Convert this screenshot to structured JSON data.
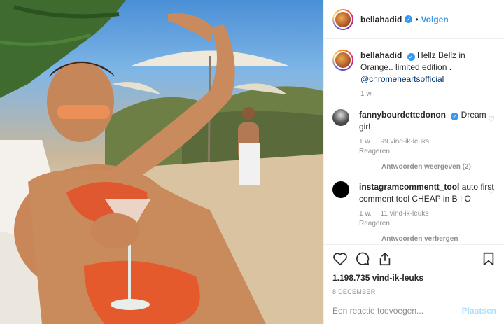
{
  "header": {
    "username": "bellahadid",
    "separator": "•",
    "follow_label": "Volgen"
  },
  "caption": {
    "username": "bellahadid",
    "text": "Hellz Bellz in Orange.. limited edition .",
    "mention": "@chromeheartsofficial",
    "age": "1 w."
  },
  "comments": [
    {
      "username": "fannybourdettedonon",
      "text": "Dream girl",
      "age": "1 w.",
      "likes": "99 vind-ik-leuks",
      "reply": "Reageren",
      "replies_toggle": "Antwoorden weergeven (2)"
    },
    {
      "username": "instagramcommentt_tool",
      "text": "auto first comment tool CHEAP in B I O",
      "age": "1 w.",
      "likes": "11 vind-ik-leuks",
      "reply": "Reageren",
      "replies_toggle": "Antwoorden verbergen"
    }
  ],
  "actions": {
    "likes": "1.198.735 vind-ik-leuks",
    "date": "8 DECEMBER",
    "icons": [
      "heart-icon",
      "comment-icon",
      "share-icon",
      "bookmark-icon"
    ]
  },
  "add_comment": {
    "placeholder": "Een reactie toevoegen...",
    "post_label": "Plaatsen"
  },
  "colors": {
    "link": "#3897f0",
    "verified": "#3897f0",
    "muted": "#8e8e8e",
    "post_disabled": "#b2dffc"
  }
}
